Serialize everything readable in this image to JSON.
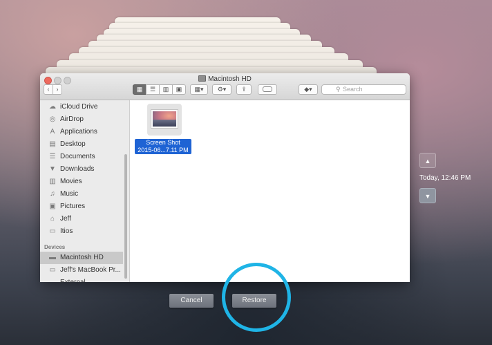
{
  "window": {
    "title": "Macintosh HD",
    "search_placeholder": "Search",
    "toolbar": {
      "view_icon": "▦",
      "view_list": "☰",
      "view_columns": "▥",
      "view_coverflow": "▣",
      "arrange": "▦▾",
      "action": "⚙▾",
      "share": "⇪",
      "dropbox": "◆▾"
    }
  },
  "sidebar": {
    "favorites": [
      {
        "label": "iCloud Drive",
        "icon": "☁"
      },
      {
        "label": "AirDrop",
        "icon": "◎"
      },
      {
        "label": "Applications",
        "icon": "A"
      },
      {
        "label": "Desktop",
        "icon": "▤"
      },
      {
        "label": "Documents",
        "icon": "☰"
      },
      {
        "label": "Downloads",
        "icon": "▼"
      },
      {
        "label": "Movies",
        "icon": "▥"
      },
      {
        "label": "Music",
        "icon": "♫"
      },
      {
        "label": "Pictures",
        "icon": "▣"
      },
      {
        "label": "Jeff",
        "icon": "⌂"
      },
      {
        "label": "Itios",
        "icon": "▭"
      }
    ],
    "devices_heading": "Devices",
    "devices": [
      {
        "label": "Macintosh HD",
        "icon": "▬"
      },
      {
        "label": "Jeff's MacBook Pr...",
        "icon": "▭"
      },
      {
        "label": "External",
        "icon": "▬"
      }
    ]
  },
  "file": {
    "name_line1": "Screen Shot",
    "name_line2": "2015-06...7.11 PM"
  },
  "buttons": {
    "cancel": "Cancel",
    "restore": "Restore"
  },
  "timemachine": {
    "up": "▲",
    "timestamp": "Today, 12:46 PM",
    "down": "▼"
  },
  "colors": {
    "accent": "#1e63d4",
    "highlight_ring": "#1fb4e6"
  }
}
